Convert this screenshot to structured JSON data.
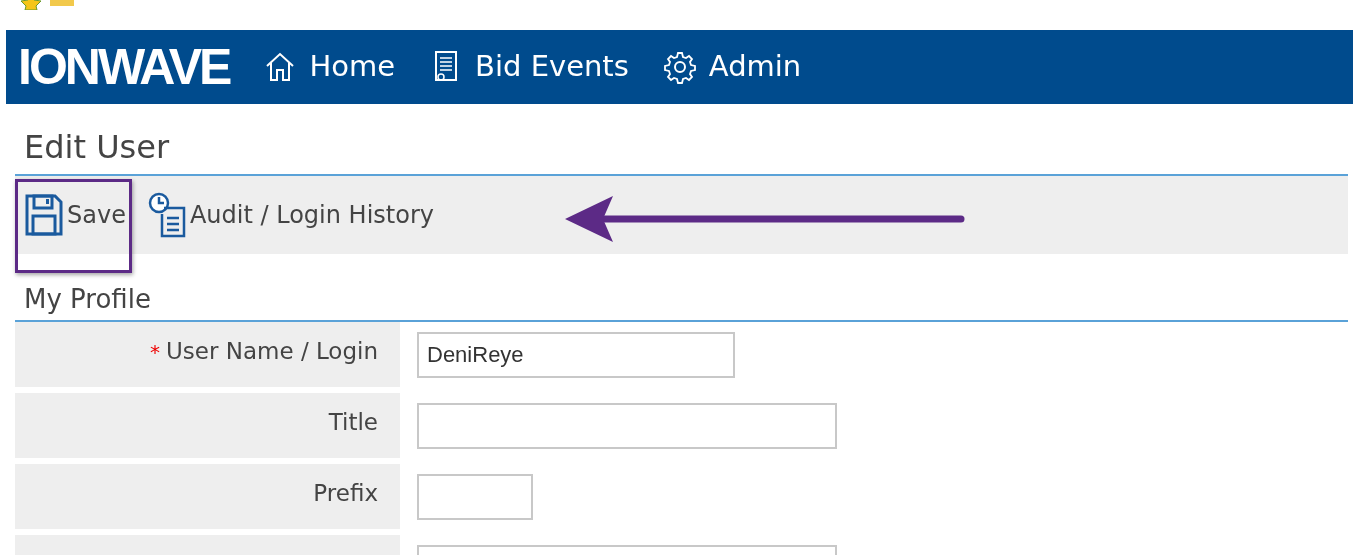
{
  "brand": {
    "logo": "IONWAVE"
  },
  "nav": [
    {
      "kind": "home",
      "label": "Home"
    },
    {
      "kind": "document",
      "label": "Bid Events"
    },
    {
      "kind": "gear",
      "label": "Admin"
    }
  ],
  "page_title": "Edit User",
  "toolbar": [
    {
      "kind": "save",
      "label": "Save",
      "highlighted": true
    },
    {
      "kind": "history",
      "label": "Audit / Login History",
      "highlighted": false
    }
  ],
  "annotations": [
    {
      "kind": "arrow",
      "color": "#5c2a86"
    }
  ],
  "section_title": "My Profile",
  "form": [
    {
      "required_mark": "*",
      "label": "User Name / Login",
      "value": "DeniReye",
      "kind": "medium"
    },
    {
      "label": "Title",
      "kind": "long"
    },
    {
      "label": "Prefix",
      "kind": "short"
    },
    {
      "kind": "long"
    }
  ]
}
